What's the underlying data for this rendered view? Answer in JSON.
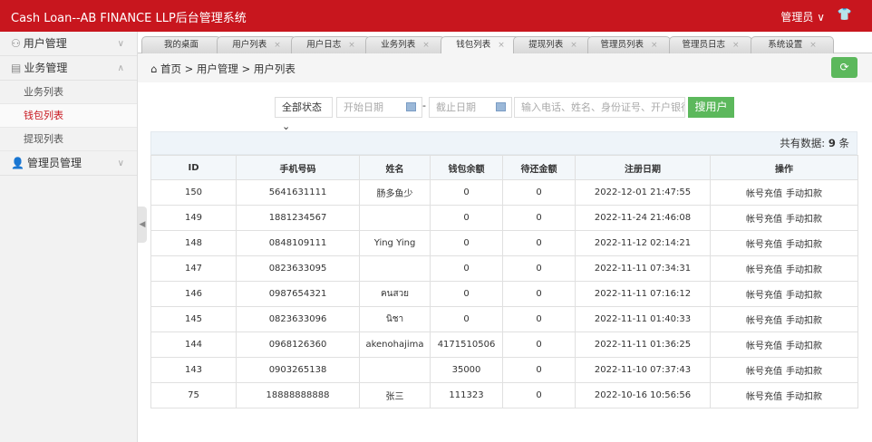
{
  "header": {
    "title": "Cash Loan--AB FINANCE LLP后台管理系统",
    "user": "管理员",
    "user_chevron": "∨",
    "shirt_icon": "👕"
  },
  "sidebar": {
    "menus": [
      {
        "icon": "⚇",
        "label": "用户管理",
        "chev": "∨"
      },
      {
        "icon": "▤",
        "label": "业务管理",
        "chev": "∧",
        "subs": [
          "业务列表",
          "钱包列表",
          "提现列表"
        ]
      },
      {
        "icon": "👤",
        "label": "管理员管理",
        "chev": "∨"
      }
    ]
  },
  "tabs": [
    {
      "label": "我的桌面"
    },
    {
      "label": "用户列表"
    },
    {
      "label": "用户日志"
    },
    {
      "label": "业务列表"
    },
    {
      "label": "钱包列表"
    },
    {
      "label": "提现列表"
    },
    {
      "label": "管理员列表"
    },
    {
      "label": "管理员日志"
    },
    {
      "label": "系统设置"
    }
  ],
  "tab_close": "×",
  "breadcrumb": {
    "home_icon": "⌂",
    "items": [
      "首页",
      "用户管理",
      "用户列表"
    ],
    "sep": ">"
  },
  "filters": {
    "status": "全部状态",
    "start_placeholder": "开始日期",
    "end_placeholder": "截止日期",
    "dash": "-",
    "search_placeholder": "输入电话、姓名、身份证号、开户银行",
    "search_button": "搜用户"
  },
  "summary": {
    "label": "共有数据:",
    "count": "9",
    "unit": "条"
  },
  "table": {
    "headers": [
      "ID",
      "手机号码",
      "姓名",
      "钱包余额",
      "待还金额",
      "注册日期",
      "操作"
    ],
    "actions": [
      "帐号充值",
      "手动扣款"
    ],
    "rows": [
      [
        "150",
        "5641631111",
        "肠多鱼少",
        "0",
        "0",
        "2022-12-01 21:47:55"
      ],
      [
        "149",
        "1881234567",
        "",
        "0",
        "0",
        "2022-11-24 21:46:08"
      ],
      [
        "148",
        "0848109111",
        "Ying Ying",
        "0",
        "0",
        "2022-11-12 02:14:21"
      ],
      [
        "147",
        "0823633095",
        "",
        "0",
        "0",
        "2022-11-11 07:34:31"
      ],
      [
        "146",
        "0987654321",
        "คนสวย",
        "0",
        "0",
        "2022-11-11 07:16:12"
      ],
      [
        "145",
        "0823633096",
        "นิชา",
        "0",
        "0",
        "2022-11-11 01:40:33"
      ],
      [
        "144",
        "0968126360",
        "akenohajima",
        "4171510506",
        "0",
        "2022-11-11 01:36:25"
      ],
      [
        "143",
        "0903265138",
        "",
        "35000",
        "0",
        "2022-11-10 07:37:43"
      ],
      [
        "75",
        "18888888888",
        "张三",
        "111323",
        "0",
        "2022-10-16 10:56:56"
      ]
    ]
  }
}
